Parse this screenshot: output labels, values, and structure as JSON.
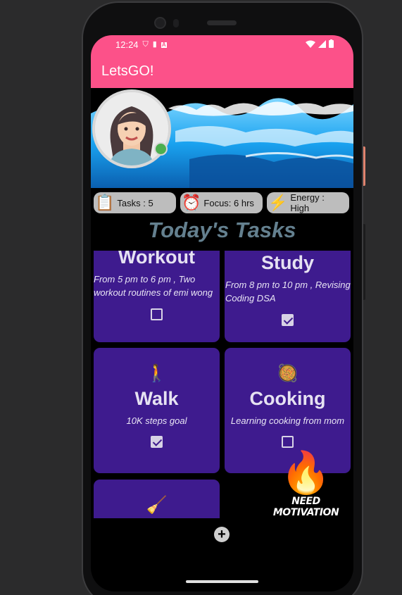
{
  "status_bar": {
    "time": "12:24"
  },
  "app_bar": {
    "title": "LetsGO!"
  },
  "stats": [
    {
      "icon": "task-file-icon",
      "label": "Tasks : 5"
    },
    {
      "icon": "alarm-clock-icon",
      "label": "Focus: 6 hrs"
    },
    {
      "icon": "lightning-icon",
      "label": "Energy : High"
    }
  ],
  "heading": "Today's Tasks",
  "tasks": [
    {
      "icon": "",
      "title": "Workout",
      "desc": "From 5 pm to 6 pm , Two workout routines of emi wong",
      "checked": false
    },
    {
      "icon": "",
      "title": "Study",
      "desc": "From 8 pm to 10 pm , Revising Coding DSA",
      "checked": true
    },
    {
      "icon": "walking-person-icon",
      "title": "Walk",
      "desc": "10K steps goal",
      "checked": true
    },
    {
      "icon": "cooking-pan-icon",
      "title": "Cooking",
      "desc": "Learning cooking from mom",
      "checked": false
    },
    {
      "icon": "broom-icon",
      "title": "",
      "desc": "",
      "checked": false
    }
  ],
  "motivation": {
    "label": "NEED MOTIVATION",
    "icon": "fire-icon"
  },
  "colors": {
    "accent": "#fc5189",
    "card": "#3e1b8e",
    "heading": "#64808f",
    "chip": "#bdbdbd"
  }
}
